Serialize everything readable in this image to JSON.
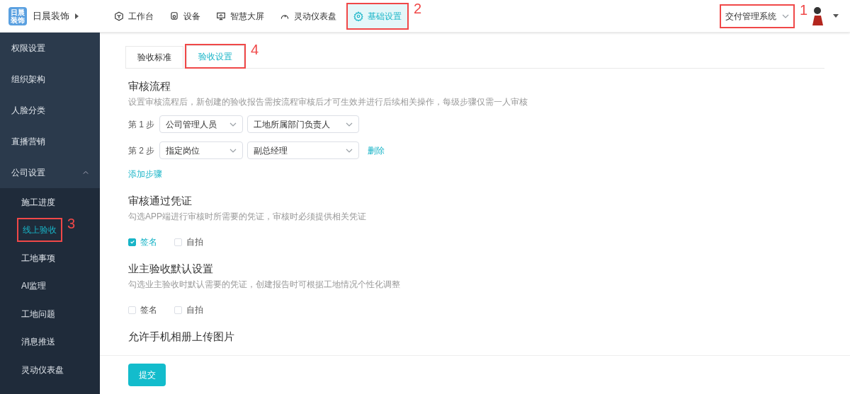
{
  "header": {
    "logo_lines": [
      "日晨",
      "装饰"
    ],
    "company": "日晨装饰",
    "nav": [
      {
        "label": "工作台",
        "selected": false
      },
      {
        "label": "设备",
        "selected": false
      },
      {
        "label": "智慧大屏",
        "selected": false
      },
      {
        "label": "灵动仪表盘",
        "selected": false
      },
      {
        "label": "基础设置",
        "selected": true,
        "annotation": "2"
      }
    ],
    "system": {
      "label": "交付管理系统",
      "annotation": "1"
    }
  },
  "sidebar": {
    "items": [
      {
        "label": "权限设置",
        "selected": false
      },
      {
        "label": "组织架构",
        "selected": false
      },
      {
        "label": "人脸分类",
        "selected": false
      },
      {
        "label": "直播营销",
        "selected": false
      },
      {
        "label": "公司设置",
        "selected": false,
        "expanded": true,
        "children": [
          {
            "label": "施工进度",
            "selected": false
          },
          {
            "label": "线上验收",
            "selected": true,
            "annotation": "3"
          },
          {
            "label": "工地事项",
            "selected": false
          },
          {
            "label": "AI监理",
            "selected": false
          },
          {
            "label": "工地问题",
            "selected": false
          },
          {
            "label": "消息推送",
            "selected": false
          },
          {
            "label": "灵动仪表盘",
            "selected": false
          }
        ]
      }
    ]
  },
  "tabs": [
    {
      "label": "验收标准",
      "selected": false
    },
    {
      "label": "验收设置",
      "selected": true,
      "annotation": "4"
    }
  ],
  "sections": [
    {
      "kind": "steps",
      "title": "审核流程",
      "description": "设置审核流程后，新创建的验收报告需按流程审核后才可生效并进行后续相关操作，每级步骤仅需一人审核",
      "steps": [
        {
          "label": "第 1 步",
          "role": "公司管理人员",
          "person": "工地所属部门负责人"
        },
        {
          "label": "第 2 步",
          "role": "指定岗位",
          "person": "副总经理",
          "delete": "删除"
        }
      ],
      "add": "添加步骤"
    },
    {
      "kind": "checks",
      "title": "审核通过凭证",
      "description": "勾选APP端进行审核时所需要的凭证，审核时必须提供相关凭证",
      "options": [
        {
          "label": "签名",
          "checked": true
        },
        {
          "label": "自拍",
          "checked": false
        }
      ]
    },
    {
      "kind": "checks",
      "title": "业主验收默认设置",
      "description": "勾选业主验收时默认需要的凭证，创建报告时可根据工地情况个性化调整",
      "options": [
        {
          "label": "签名",
          "checked": false
        },
        {
          "label": "自拍",
          "checked": false
        }
      ]
    },
    {
      "kind": "title",
      "title": "允许手机相册上传图片"
    }
  ],
  "submit": "提交"
}
